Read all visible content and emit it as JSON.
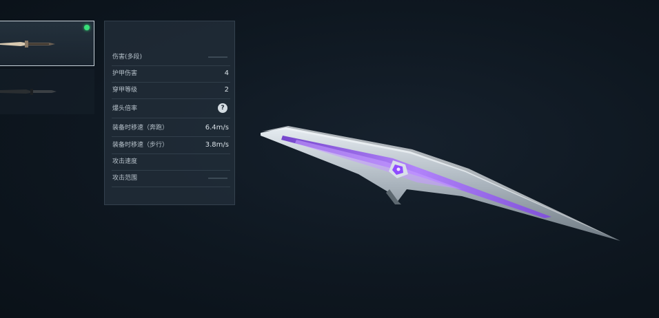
{
  "weapons": [
    {
      "icon": "knife-icon",
      "selected": true,
      "equipped": true
    },
    {
      "icon": "black-knife-icon",
      "selected": false,
      "equipped": false
    }
  ],
  "stats": {
    "damage_multi": {
      "label": "伤害(多段)",
      "value": ""
    },
    "armor_damage": {
      "label": "护甲伤害",
      "value": "4"
    },
    "armor_pierce": {
      "label": "穿甲等级",
      "value": "2"
    },
    "headshot_mult": {
      "label": "爆头倍率",
      "value": "?"
    },
    "move_speed_run": {
      "label": "装备时移速（奔跑）",
      "value": "6.4m/s"
    },
    "move_speed_walk": {
      "label": "装备时移速（步行）",
      "value": "3.8m/s"
    },
    "attack_speed": {
      "label": "攻击速度",
      "value": ""
    },
    "attack_range": {
      "label": "攻击范围",
      "value": ""
    }
  },
  "colors": {
    "equipped_dot": "#39e07a",
    "blade_glow": "#9b5cff",
    "blade_silver": "#c9d3dc"
  },
  "model": {
    "name": "knife-model"
  }
}
